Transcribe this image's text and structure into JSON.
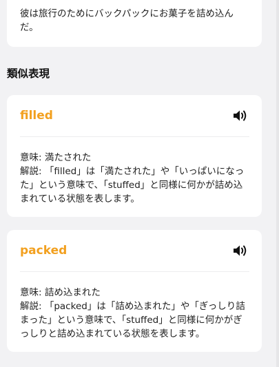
{
  "example": {
    "text": "彼は旅行のためにバックパックにお菓子を詰め込んだ。"
  },
  "section": {
    "title": "類似表現"
  },
  "synonyms": [
    {
      "word": "filled",
      "meaning": "意味: 満たされた",
      "explanation": "解説: 「filled」は「満たされた」や「いっぱいになった」という意味で、「stuffed」と同様に何かが詰め込まれている状態を表します。",
      "icon": "speaker-icon"
    },
    {
      "word": "packed",
      "meaning": "意味: 詰め込まれた",
      "explanation": "解説: 「packed」は「詰め込まれた」や「ぎっしり詰まった」という意味で、「stuffed」と同様に何かがぎっしりと詰め込まれている状態を表します。",
      "icon": "speaker-icon"
    }
  ],
  "colors": {
    "accent": "#f2a01f",
    "background": "#f2f2f4",
    "card": "#ffffff"
  }
}
